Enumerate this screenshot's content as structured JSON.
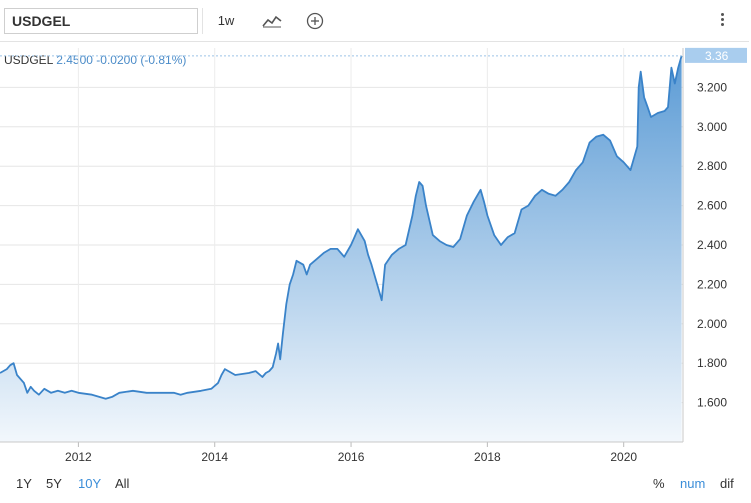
{
  "toolbar": {
    "symbol": "USDGEL",
    "interval": "1w",
    "chart_type_icon": "line-chart-icon",
    "compare_icon": "plus-circle-icon",
    "menu_icon": "vertical-dots-icon"
  },
  "quote": {
    "symbol": "USDGEL",
    "price": "2.4500",
    "change": "-0.0200",
    "change_pct": "(-0.81%)"
  },
  "range_buttons": [
    "1Y",
    "5Y",
    "10Y",
    "All"
  ],
  "active_range": "10Y",
  "scale_options": [
    "%",
    "num",
    "dif"
  ],
  "active_scale": "num",
  "colors": {
    "line": "#3a83c9",
    "fill_top": "#5b9bd5",
    "fill_bottom": "#f2f7fc",
    "active": "#3a8dd8",
    "last_price_bg": "#a9cdee"
  },
  "chart_data": {
    "type": "area",
    "title": "",
    "xlabel": "",
    "ylabel": "",
    "xlim": [
      2010.85,
      2020.87
    ],
    "ylim": [
      1.4,
      3.4
    ],
    "x_ticks": [
      "2012",
      "2014",
      "2016",
      "2018",
      "2020"
    ],
    "y_ticks": [
      "1.600",
      "1.800",
      "2.000",
      "2.200",
      "2.400",
      "2.600",
      "2.800",
      "3.000",
      "3.200"
    ],
    "last_price_label": "3.36",
    "grid": true,
    "series": [
      {
        "x": [
          2010.85,
          2010.95,
          2011.0,
          2011.05,
          2011.1,
          2011.2,
          2011.25,
          2011.3,
          2011.35,
          2011.42,
          2011.5,
          2011.6,
          2011.7,
          2011.8,
          2011.9,
          2012.0,
          2012.2,
          2012.4,
          2012.5,
          2012.6,
          2012.8,
          2013.0,
          2013.2,
          2013.4,
          2013.5,
          2013.6,
          2013.8,
          2013.95,
          2014.05,
          2014.1,
          2014.15,
          2014.3,
          2014.5,
          2014.6,
          2014.7,
          2014.75,
          2014.8,
          2014.85,
          2014.9,
          2014.93,
          2014.96,
          2015.0,
          2015.05,
          2015.1,
          2015.15,
          2015.2,
          2015.3,
          2015.35,
          2015.4,
          2015.5,
          2015.6,
          2015.7,
          2015.8,
          2015.9,
          2016.0,
          2016.05,
          2016.1,
          2016.2,
          2016.25,
          2016.3,
          2016.4,
          2016.45,
          2016.5,
          2016.6,
          2016.7,
          2016.8,
          2016.9,
          2016.95,
          2017.0,
          2017.05,
          2017.1,
          2017.2,
          2017.3,
          2017.4,
          2017.5,
          2017.6,
          2017.7,
          2017.8,
          2017.9,
          2017.95,
          2018.0,
          2018.1,
          2018.2,
          2018.3,
          2018.4,
          2018.5,
          2018.6,
          2018.7,
          2018.8,
          2018.9,
          2019.0,
          2019.1,
          2019.2,
          2019.3,
          2019.4,
          2019.5,
          2019.6,
          2019.7,
          2019.8,
          2019.9,
          2020.0,
          2020.1,
          2020.2,
          2020.22,
          2020.25,
          2020.3,
          2020.35,
          2020.4,
          2020.5,
          2020.6,
          2020.65,
          2020.7,
          2020.75,
          2020.8,
          2020.85
        ],
        "values": [
          1.75,
          1.77,
          1.79,
          1.8,
          1.74,
          1.7,
          1.65,
          1.68,
          1.66,
          1.64,
          1.67,
          1.65,
          1.66,
          1.65,
          1.66,
          1.65,
          1.64,
          1.62,
          1.63,
          1.65,
          1.66,
          1.65,
          1.65,
          1.65,
          1.64,
          1.65,
          1.66,
          1.67,
          1.7,
          1.74,
          1.77,
          1.74,
          1.75,
          1.76,
          1.73,
          1.75,
          1.76,
          1.78,
          1.85,
          1.9,
          1.82,
          1.95,
          2.1,
          2.2,
          2.25,
          2.32,
          2.3,
          2.25,
          2.3,
          2.33,
          2.36,
          2.38,
          2.38,
          2.34,
          2.4,
          2.44,
          2.48,
          2.42,
          2.35,
          2.3,
          2.18,
          2.12,
          2.3,
          2.35,
          2.38,
          2.4,
          2.55,
          2.65,
          2.72,
          2.7,
          2.6,
          2.45,
          2.42,
          2.4,
          2.39,
          2.43,
          2.55,
          2.62,
          2.68,
          2.62,
          2.55,
          2.45,
          2.4,
          2.44,
          2.46,
          2.58,
          2.6,
          2.65,
          2.68,
          2.66,
          2.65,
          2.68,
          2.72,
          2.78,
          2.82,
          2.92,
          2.95,
          2.96,
          2.93,
          2.85,
          2.82,
          2.78,
          2.9,
          3.2,
          3.28,
          3.15,
          3.1,
          3.05,
          3.07,
          3.08,
          3.1,
          3.3,
          3.22,
          3.3,
          3.36
        ]
      }
    ]
  }
}
